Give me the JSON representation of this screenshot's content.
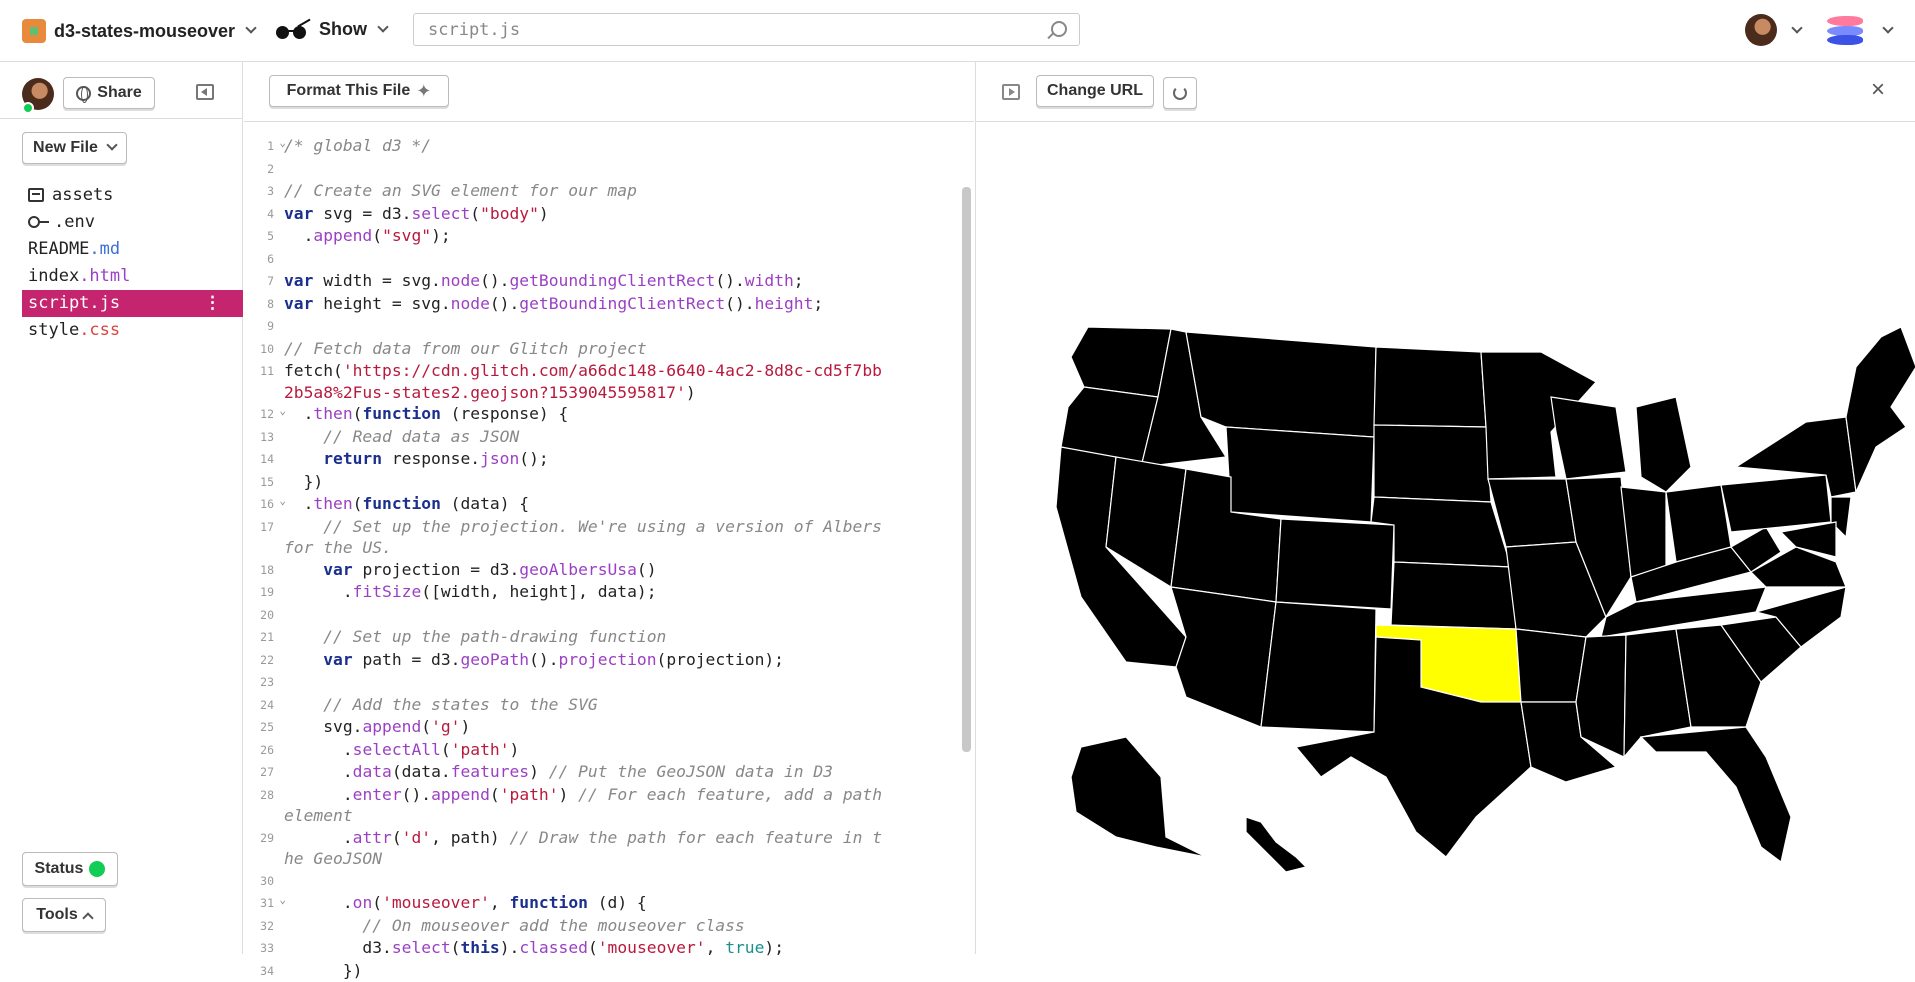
{
  "project": {
    "name": "d3-states-mouseover",
    "show_label": "Show"
  },
  "search": {
    "placeholder": "script.js"
  },
  "sidebar": {
    "share_label": "Share",
    "new_file_label": "New File",
    "files": [
      {
        "base": "assets",
        "ext": ""
      },
      {
        "base": ".env",
        "ext": ""
      },
      {
        "base": "README",
        "ext": ".md"
      },
      {
        "base": "index",
        "ext": ".html"
      },
      {
        "base": "script",
        "ext": ".js"
      },
      {
        "base": "style",
        "ext": ".css"
      }
    ],
    "status_label": "Status",
    "tools_label": "Tools"
  },
  "editor": {
    "format_label": "Format This File"
  },
  "preview": {
    "change_url_label": "Change URL",
    "highlight_color": "#ffff00",
    "state_color": "#000000"
  },
  "code_lines": [
    {
      "n": "1",
      "fold": true,
      "html": "<span class='t-cmt'>/* global d3 */</span>"
    },
    {
      "n": "2",
      "html": ""
    },
    {
      "n": "3",
      "html": "<span class='t-cmt'>// Create an SVG element for our map</span>"
    },
    {
      "n": "4",
      "html": "<span class='t-kw'>var</span> svg = d3.<span class='t-fn'>select</span>(<span class='t-str'>\"body\"</span>)"
    },
    {
      "n": "5",
      "html": "  .<span class='t-fn'>append</span>(<span class='t-str'>\"svg\"</span>);"
    },
    {
      "n": "6",
      "html": ""
    },
    {
      "n": "7",
      "html": "<span class='t-kw'>var</span> width = svg.<span class='t-fn'>node</span>().<span class='t-fn'>getBoundingClientRect</span>().<span class='t-fn'>width</span>;"
    },
    {
      "n": "8",
      "html": "<span class='t-kw'>var</span> height = svg.<span class='t-fn'>node</span>().<span class='t-fn'>getBoundingClientRect</span>().<span class='t-fn'>height</span>;"
    },
    {
      "n": "9",
      "html": ""
    },
    {
      "n": "10",
      "html": "<span class='t-cmt'>// Fetch data from our Glitch project</span>"
    },
    {
      "n": "11",
      "html": "fetch(<span class='t-str'>'https://cdn.glitch.com/a66dc148-6640-4ac2-8d8c-cd5f7bb2b5a8%2Fus-states2.geojson?1539045595817'</span>)"
    },
    {
      "n": "12",
      "fold": true,
      "html": "  .<span class='t-fn'>then</span>(<span class='t-kw'>function</span> (response) {"
    },
    {
      "n": "13",
      "html": "    <span class='t-cmt'>// Read data as JSON</span>"
    },
    {
      "n": "14",
      "html": "    <span class='t-kw'>return</span> response.<span class='t-fn'>json</span>();"
    },
    {
      "n": "15",
      "html": "  })"
    },
    {
      "n": "16",
      "fold": true,
      "html": "  .<span class='t-fn'>then</span>(<span class='t-kw'>function</span> (data) {"
    },
    {
      "n": "17",
      "html": "    <span class='t-cmt'>// Set up the projection. We're using a version of Albers for the US.</span>"
    },
    {
      "n": "18",
      "html": "    <span class='t-kw'>var</span> projection = d3.<span class='t-fn'>geoAlbersUsa</span>()"
    },
    {
      "n": "19",
      "html": "      .<span class='t-fn'>fitSize</span>([width, height], data);"
    },
    {
      "n": "20",
      "html": ""
    },
    {
      "n": "21",
      "html": "    <span class='t-cmt'>// Set up the path-drawing function</span>"
    },
    {
      "n": "22",
      "html": "    <span class='t-kw'>var</span> path = d3.<span class='t-fn'>geoPath</span>().<span class='t-fn'>projection</span>(projection);"
    },
    {
      "n": "23",
      "html": ""
    },
    {
      "n": "24",
      "html": "    <span class='t-cmt'>// Add the states to the SVG</span>"
    },
    {
      "n": "25",
      "html": "    svg.<span class='t-fn'>append</span>(<span class='t-str'>'g'</span>)"
    },
    {
      "n": "26",
      "html": "      .<span class='t-fn'>selectAll</span>(<span class='t-str'>'path'</span>)"
    },
    {
      "n": "27",
      "html": "      .<span class='t-fn'>data</span>(data.<span class='t-fn'>features</span>) <span class='t-cmt'>// Put the GeoJSON data in D3</span>"
    },
    {
      "n": "28",
      "html": "      .<span class='t-fn'>enter</span>().<span class='t-fn'>append</span>(<span class='t-str'>'path'</span>) <span class='t-cmt'>// For each feature, add a path element</span>"
    },
    {
      "n": "29",
      "html": "      .<span class='t-fn'>attr</span>(<span class='t-str'>'d'</span>, path) <span class='t-cmt'>// Draw the path for each feature in the GeoJSON</span>"
    },
    {
      "n": "30",
      "html": ""
    },
    {
      "n": "31",
      "fold": true,
      "html": "      .<span class='t-fn'>on</span>(<span class='t-str'>'mouseover'</span>, <span class='t-kw'>function</span> (d) {"
    },
    {
      "n": "32",
      "html": "        <span class='t-cmt'>// On mouseover add the mouseover class</span>"
    },
    {
      "n": "33",
      "html": "        d3.<span class='t-fn'>select</span>(<span class='t-kw'>this</span>).<span class='t-fn'>classed</span>(<span class='t-str'>'mouseover'</span>, <span class='t-bool'>true</span>);"
    },
    {
      "n": "34",
      "html": "      })"
    }
  ]
}
